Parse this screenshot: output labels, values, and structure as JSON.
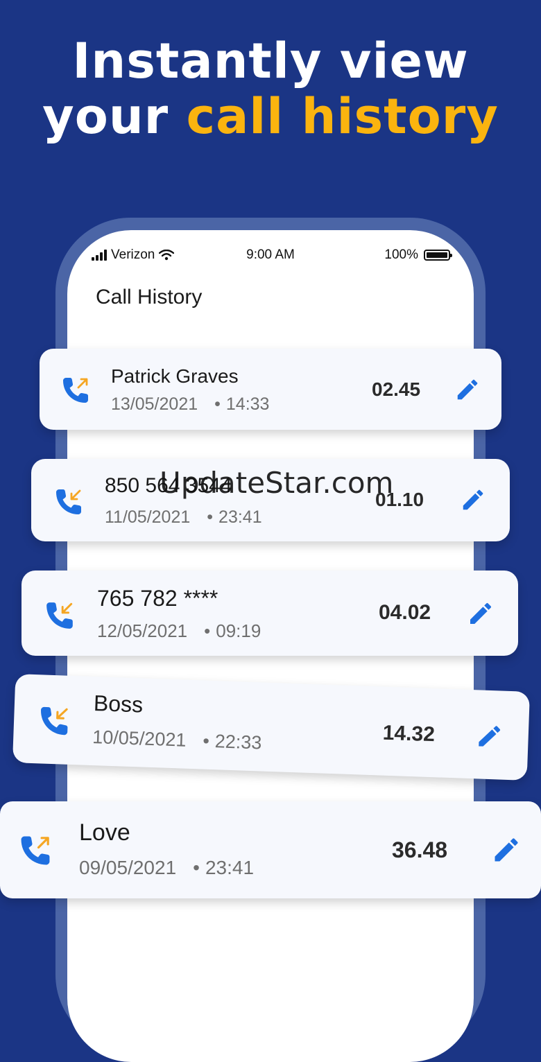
{
  "headline": {
    "line1": "Instantly view",
    "line2_prefix": "your",
    "line2_accent": "call history"
  },
  "status_bar": {
    "carrier": "Verizon",
    "time": "9:00 AM",
    "battery": "100%"
  },
  "screen_title": "Call History",
  "calls": [
    {
      "name": "Patrick Graves",
      "date": "13/05/2021",
      "time": "14:33",
      "duration": "02.45",
      "direction": "outgoing"
    },
    {
      "name": "850 564 3544",
      "date": "11/05/2021",
      "time": "23:41",
      "duration": "01.10",
      "direction": "incoming"
    },
    {
      "name": "765 782 ****",
      "date": "12/05/2021",
      "time": "09:19",
      "duration": "04.02",
      "direction": "incoming"
    },
    {
      "name": "Boss",
      "date": "10/05/2021",
      "time": "22:33",
      "duration": "14.32",
      "direction": "incoming"
    },
    {
      "name": "Love",
      "date": "09/05/2021",
      "time": "23:41",
      "duration": "36.48",
      "direction": "outgoing"
    }
  ],
  "watermark": "UpdateStar.com",
  "colors": {
    "background": "#1b3585",
    "accent": "#fbb40f",
    "icon_blue": "#1e6fe0",
    "arrow_orange": "#f5a623"
  }
}
